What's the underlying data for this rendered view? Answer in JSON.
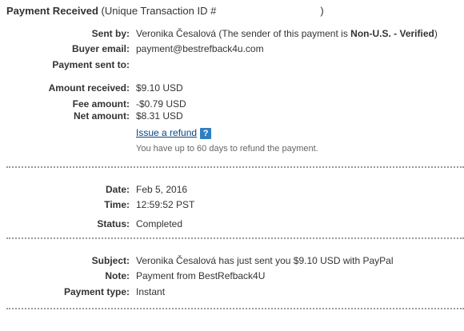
{
  "header": {
    "title": "Payment Received",
    "txid_prefix": "(Unique Transaction ID #",
    "txid_suffix": ")"
  },
  "sender": {
    "sent_by_label": "Sent by:",
    "sent_by_name": "Veronika Česalová",
    "sent_by_note_pre": "(The sender of this payment is",
    "sent_by_status": "Non-U.S. - Verified",
    "sent_by_note_post": ")",
    "buyer_email_label": "Buyer email:",
    "buyer_email": "payment@bestrefback4u.com",
    "sent_to_label": "Payment sent to:",
    "sent_to": ""
  },
  "amounts": {
    "received_label": "Amount received:",
    "received": "$9.10 USD",
    "fee_label": "Fee amount:",
    "fee": "-$0.79 USD",
    "net_label": "Net amount:",
    "net": "$8.31 USD",
    "refund_link": "Issue a refund",
    "help_icon": "?",
    "refund_note": "You have up to 60 days to refund the payment."
  },
  "details": {
    "date_label": "Date:",
    "date": "Feb 5, 2016",
    "time_label": "Time:",
    "time": "12:59:52 PST",
    "status_label": "Status:",
    "status": "Completed"
  },
  "message": {
    "subject_label": "Subject:",
    "subject": "Veronika Česalová has just sent you $9.10 USD with PayPal",
    "note_label": "Note:",
    "note": "Payment from BestRefback4U",
    "type_label": "Payment type:",
    "type": "Instant"
  }
}
